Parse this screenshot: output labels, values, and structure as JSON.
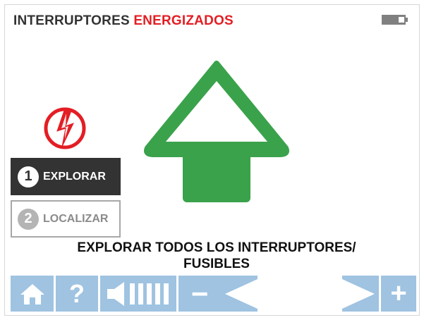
{
  "header": {
    "title_part1": "INTERRUPTORES",
    "title_part2": "ENERGIZADOS",
    "title_part2_color": "#e31e24"
  },
  "status": {
    "battery_icon": "battery-icon"
  },
  "hazard": {
    "icon": "high-voltage-warning-icon",
    "color": "#e31e24"
  },
  "modes": [
    {
      "number": "1",
      "label": "EXPLORAR",
      "selected": true
    },
    {
      "number": "2",
      "label": "LOCALIZAR",
      "selected": false
    }
  ],
  "direction_indicator": {
    "icon": "up-arrow-icon",
    "color": "#3aa24b"
  },
  "instruction": {
    "line1": "EXPLORAR TODOS LOS INTERRUPTORES/",
    "line2": "FUSIBLES"
  },
  "toolbar": {
    "color": "#9fc3e1",
    "home_icon": "home-icon",
    "help_label": "?",
    "volume_icon": "volume-icon",
    "minus_label": "−",
    "left_icon": "left-triangle-icon",
    "right_icon": "right-triangle-icon",
    "plus_label": "+"
  }
}
